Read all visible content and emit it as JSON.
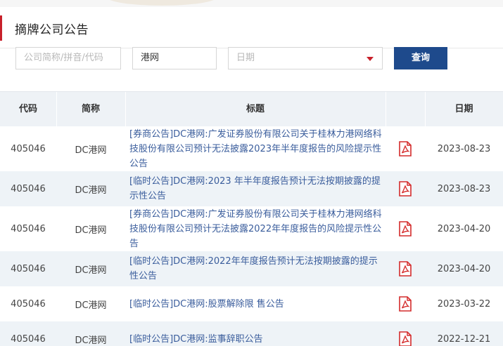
{
  "header": {
    "title": "摘牌公司公告"
  },
  "search": {
    "code_placeholder": "公司简称/拼音/代码",
    "keyword_value": "港网",
    "date_placeholder": "日期",
    "query_label": "查询"
  },
  "table": {
    "columns": [
      "代码",
      "简称",
      "标题",
      "日期"
    ],
    "rows": [
      {
        "code": "405046",
        "abbr": "DC港网",
        "title": "[券商公告]DC港网:广发证券股份有限公司关于桂林力港网络科技股份有限公司预计无法披露2023年半年度报告的风险提示性公告",
        "date": "2023-08-23"
      },
      {
        "code": "405046",
        "abbr": "DC港网",
        "title": "[临时公告]DC港网:2023 年半年度报告预计无法按期披露的提示性公告",
        "date": "2023-08-23"
      },
      {
        "code": "405046",
        "abbr": "DC港网",
        "title": "[券商公告]DC港网:广发证券股份有限公司关于桂林力港网络科技股份有限公司预计无法披露2022年年度报告的风险提示性公告",
        "date": "2023-04-20"
      },
      {
        "code": "405046",
        "abbr": "DC港网",
        "title": "[临时公告]DC港网:2022年年度报告预计无法按期披露的提示性公告",
        "date": "2023-04-20"
      },
      {
        "code": "405046",
        "abbr": "DC港网",
        "title": "[临时公告]DC港网:股票解除限 售公告",
        "date": "2023-03-22"
      },
      {
        "code": "405046",
        "abbr": "DC港网",
        "title": "[临时公告]DC港网:监事辞职公告",
        "date": "2022-12-21"
      }
    ]
  },
  "icons": {
    "pdf": "pdf-file-icon",
    "dropdown": "dropdown-caret-icon"
  },
  "colors": {
    "accent_red": "#c8202a",
    "button_blue": "#1e4a8c",
    "link_blue": "#3a5d9c"
  }
}
